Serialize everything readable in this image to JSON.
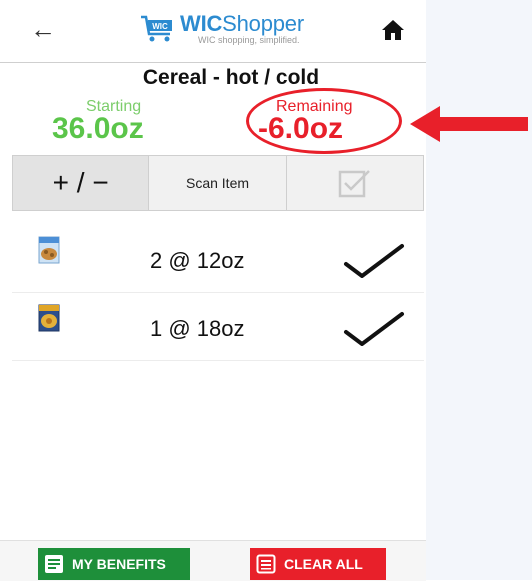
{
  "header": {
    "brand_wic": "WIC",
    "brand_shopper": "Shopper",
    "tagline": "WIC shopping, simplified.",
    "cart_label": "WIC"
  },
  "category": {
    "title": "Cereal - hot / cold"
  },
  "balance": {
    "starting_label": "Starting",
    "starting_value": "36.0oz",
    "remaining_label": "Remaining",
    "remaining_value": "-6.0oz"
  },
  "toolbar": {
    "plus_minus_label": "+ / −",
    "scan_label": "Scan Item"
  },
  "items": [
    {
      "qty": "2 @ 12oz",
      "icon": "cereal-box-icon"
    },
    {
      "qty": "1 @ 18oz",
      "icon": "cereal-box-icon"
    }
  ],
  "footer": {
    "benefits_label": "MY BENEFITS",
    "clear_label": "CLEAR ALL"
  },
  "colors": {
    "brand_blue": "#2c8bd0",
    "starting_green": "#5bc54a",
    "remaining_red": "#e8202a",
    "benefits_green": "#1e8f3a"
  }
}
